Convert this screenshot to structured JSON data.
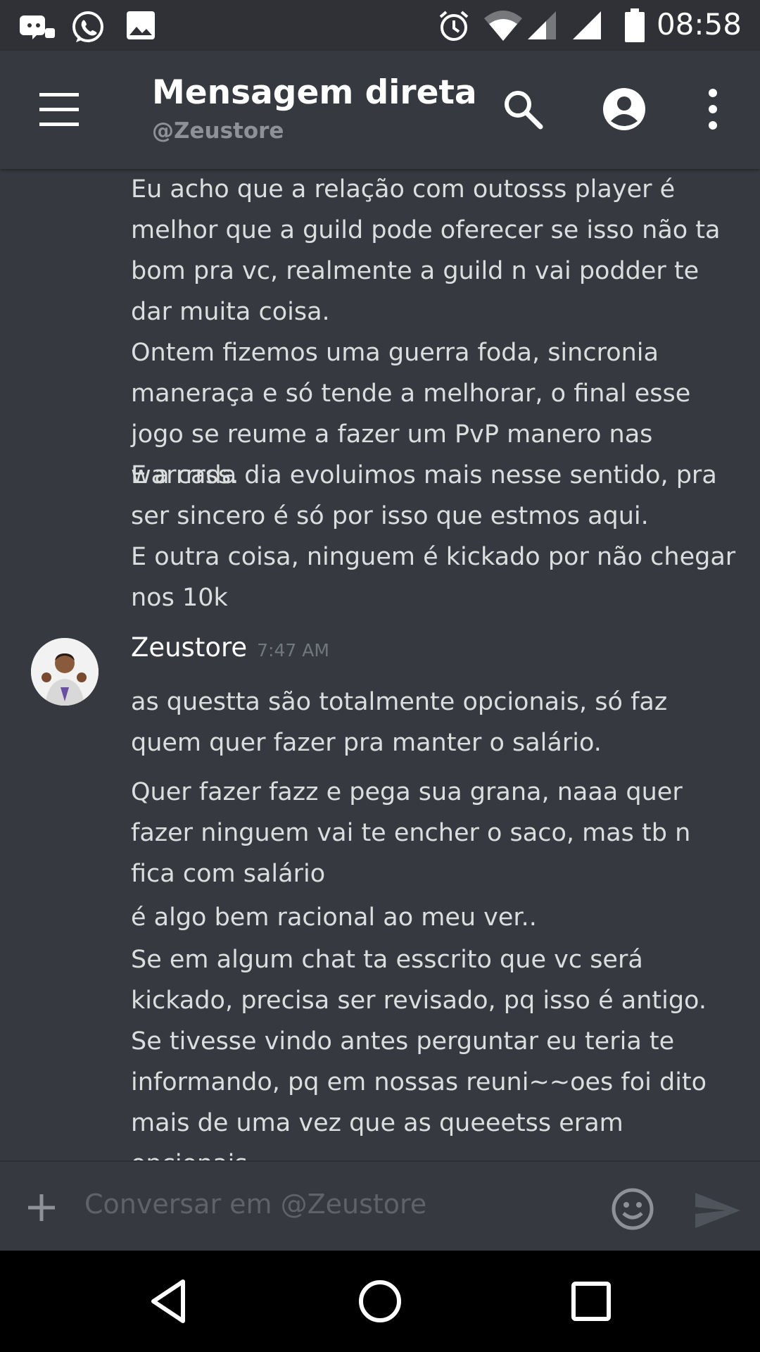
{
  "status_bar": {
    "time": "08:58",
    "left_icons": [
      "discord-controller-icon",
      "whatsapp-icon",
      "gallery-icon"
    ],
    "right_icons": [
      "alarm-icon",
      "wifi-icon",
      "signal-icon",
      "signal-icon",
      "battery-icon"
    ]
  },
  "header": {
    "title": "Mensagem direta",
    "subtitle": "@Zeustore",
    "icons": [
      "menu-icon",
      "search-icon",
      "profile-icon",
      "more-vertical-icon"
    ]
  },
  "messages": {
    "previous_lines": [
      "Eu acho que a relação com outosss player é melhor que a guild pode oferecer se isso não ta bom pra vc, realmente a guild n vai podder te dar muita coisa.",
      "Ontem fizemos uma guerra foda, sincronia maneraça e só tende a melhorar, o final esse jogo se reume a fazer um PvP manero nas warrrrss.",
      "E a  cada dia evoluimos mais nesse sentido, pra ser sincero é só por isso que estmos aqui.",
      "E outra coisa, ninguem é kickado por não chegar nos 10k"
    ],
    "group": {
      "author": "Zeustore",
      "timestamp": "7:47 AM",
      "first": "as questta são totalmente opcionais, só faz quem quer fazer pra manter o salário.",
      "second": [
        "Quer fazer fazz e pega sua grana, naaa quer fazer ninguem vai te encher o saco, mas tb n fica com salário",
        "é algo bem racional ao meu ver..",
        "Se em algum chat ta esscrito que vc será kickado, precisa ser revisado,  pq isso é antigo. Se tivesse vindo antes perguntar eu teria te informando, pq em nossas reuni~~oes foi dito mais de uma vez que as queeetss eram opcionais."
      ]
    }
  },
  "composer": {
    "placeholder": "Conversar em @Zeustore",
    "icons": [
      "plus-icon",
      "emoji-icon",
      "send-icon"
    ]
  },
  "nav_bar": {
    "icons": [
      "back-icon",
      "home-icon",
      "recents-icon"
    ]
  },
  "colors": {
    "background": "#36393f",
    "status_bar": "#2f3136",
    "text": "#dcddde",
    "muted": "#72767d"
  }
}
